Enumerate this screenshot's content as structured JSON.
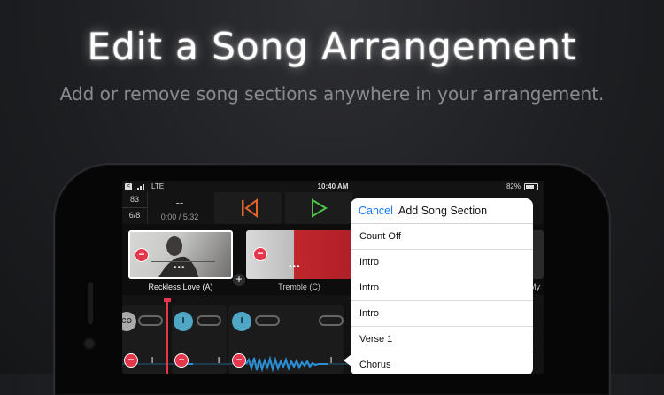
{
  "headline": "Edit a Song Arrangement",
  "subheadline": "Add or remove song sections anywhere in your arrangement.",
  "status_bar": {
    "back_glyph": "<",
    "network": "LTE",
    "time": "10:40 AM",
    "battery": "82%"
  },
  "transport": {
    "tempo": "83",
    "time_signature": "6/8",
    "song_label": "--",
    "position": "0:00 / 5:32"
  },
  "sections": [
    {
      "label": "Reckless Love (A)"
    },
    {
      "label": "Tremble (C)"
    },
    {
      "label": "My"
    }
  ],
  "track": {
    "node_label": "I",
    "cut_label": "CO"
  },
  "popover": {
    "cancel_label": "Cancel",
    "title": "Add Song Section",
    "items": [
      "Count Off",
      "Intro",
      "Intro",
      "Intro",
      "Verse 1",
      "Chorus"
    ]
  },
  "colors": {
    "accent_red": "#e5374c",
    "accent_blue": "#1a7cf0",
    "play_green": "#4fc24a",
    "skip_orange": "#e8632b",
    "node_blue": "#4fa6c5"
  }
}
